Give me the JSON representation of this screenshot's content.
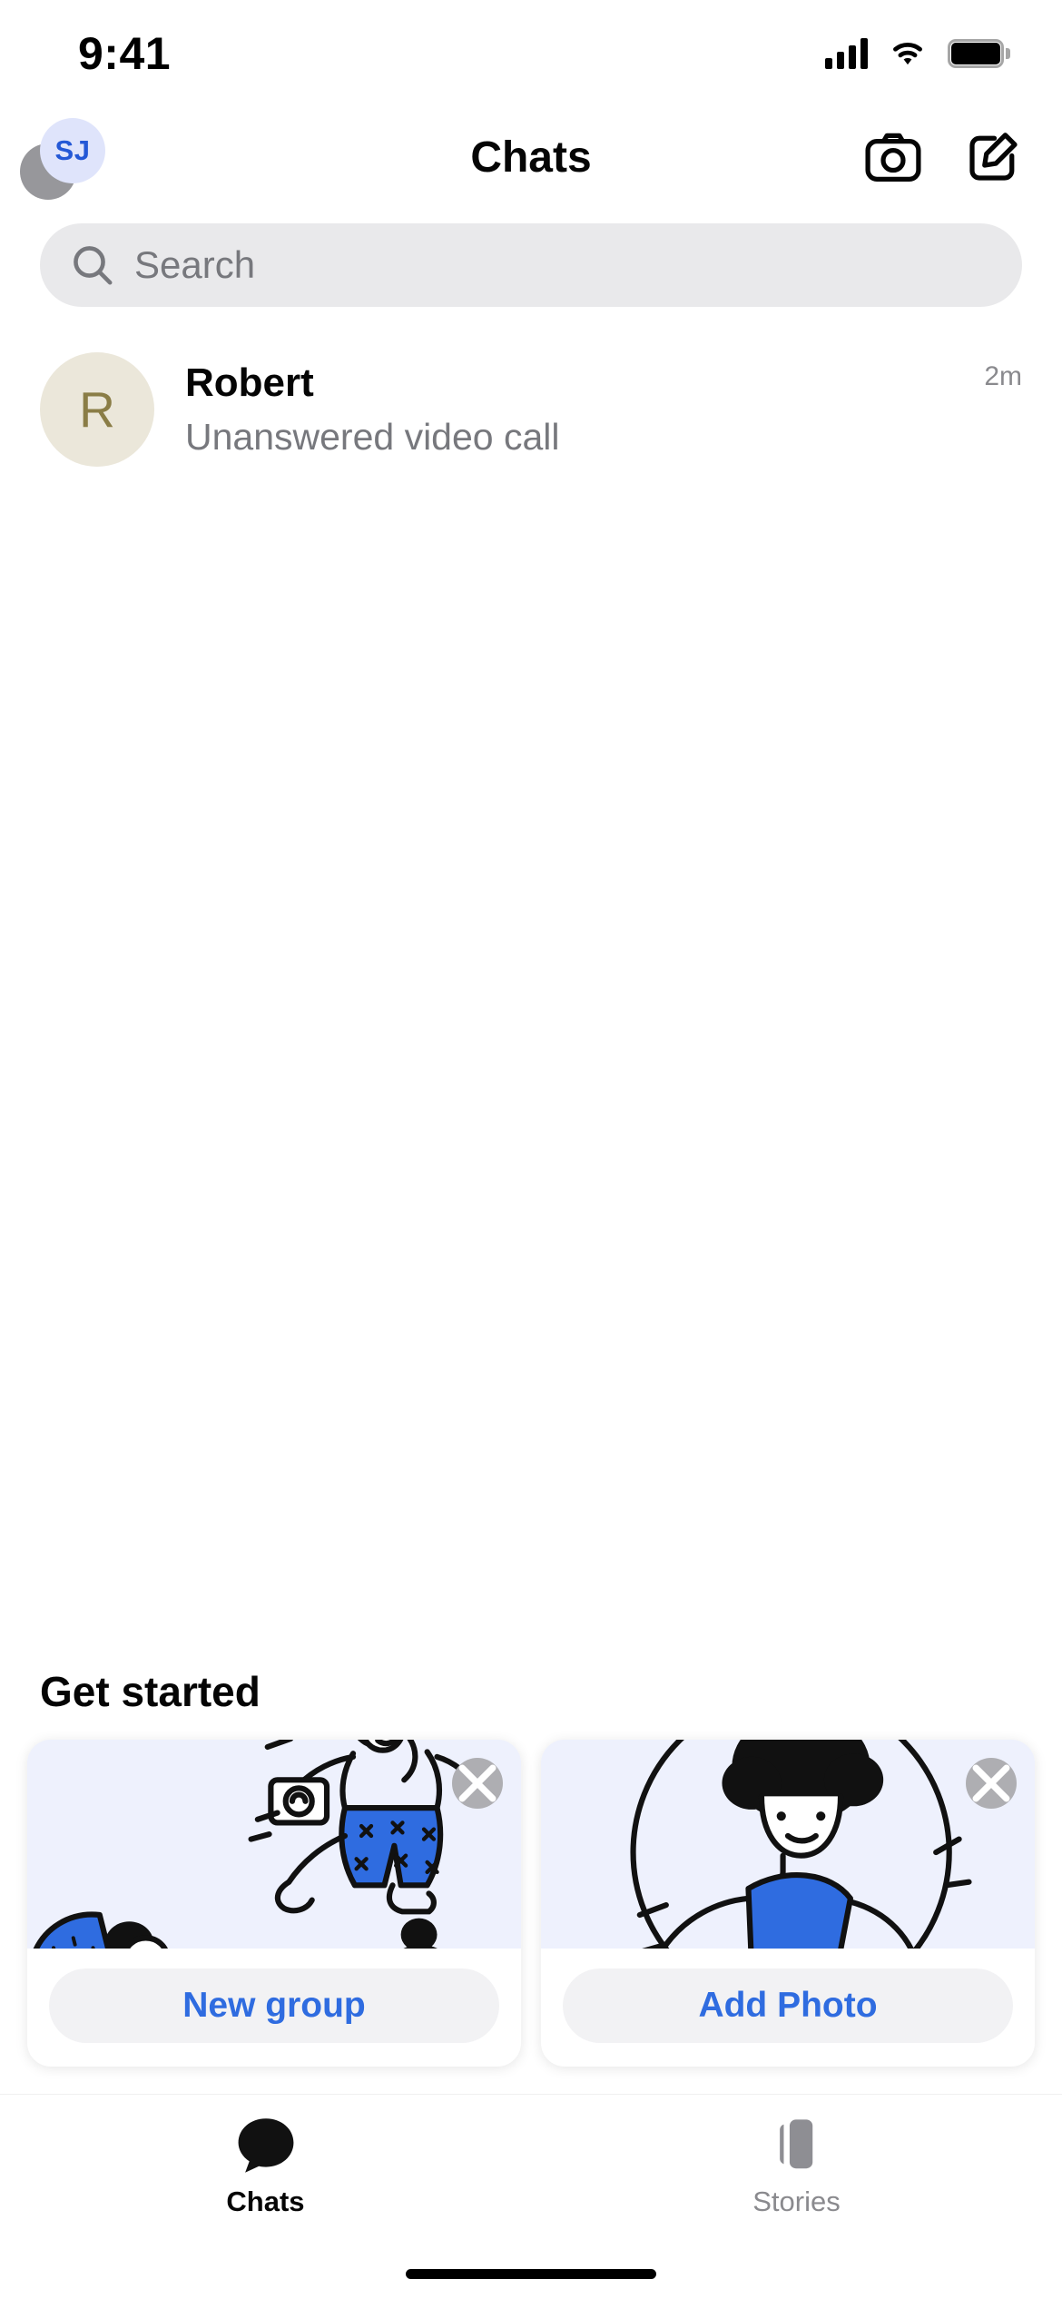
{
  "status_bar": {
    "time": "9:41",
    "signal_icon": "cellular-signal-icon",
    "wifi_icon": "wifi-icon",
    "battery_icon": "battery-full-icon"
  },
  "header": {
    "title": "Chats",
    "avatar_initials": "SJ",
    "avatar_bg": "#DFE4FB",
    "avatar_text_color": "#2458D6",
    "badge_color": "#8E8E93",
    "camera_button": "camera-icon",
    "compose_button": "compose-icon"
  },
  "search": {
    "placeholder": "Search",
    "value": "",
    "icon": "search-icon",
    "background": "#E9E9EB"
  },
  "chats": [
    {
      "name": "Robert",
      "snippet": "Unanswered video call",
      "time": "2m",
      "avatar_initial": "R",
      "avatar_bg": "#EBE7DA",
      "avatar_text_color": "#8A7D46"
    }
  ],
  "get_started": {
    "title": "Get started",
    "cards": [
      {
        "button_label": "New group",
        "illustration": "people-running-illustration",
        "close_icon": "close-icon",
        "art_bg": "#EEF1FD"
      },
      {
        "button_label": "Add Photo",
        "illustration": "person-portrait-illustration",
        "close_icon": "close-icon",
        "art_bg": "#EEF1FD"
      }
    ]
  },
  "tab_bar": {
    "accent_color": "#050505",
    "inactive_color": "#8A8A8E",
    "tabs": [
      {
        "label": "Chats",
        "icon": "chat-bubble-icon",
        "active": true
      },
      {
        "label": "Stories",
        "icon": "stories-cards-icon",
        "active": false
      }
    ]
  },
  "theme": {
    "link_blue": "#2F6CE0",
    "background": "#FFFFFF"
  }
}
